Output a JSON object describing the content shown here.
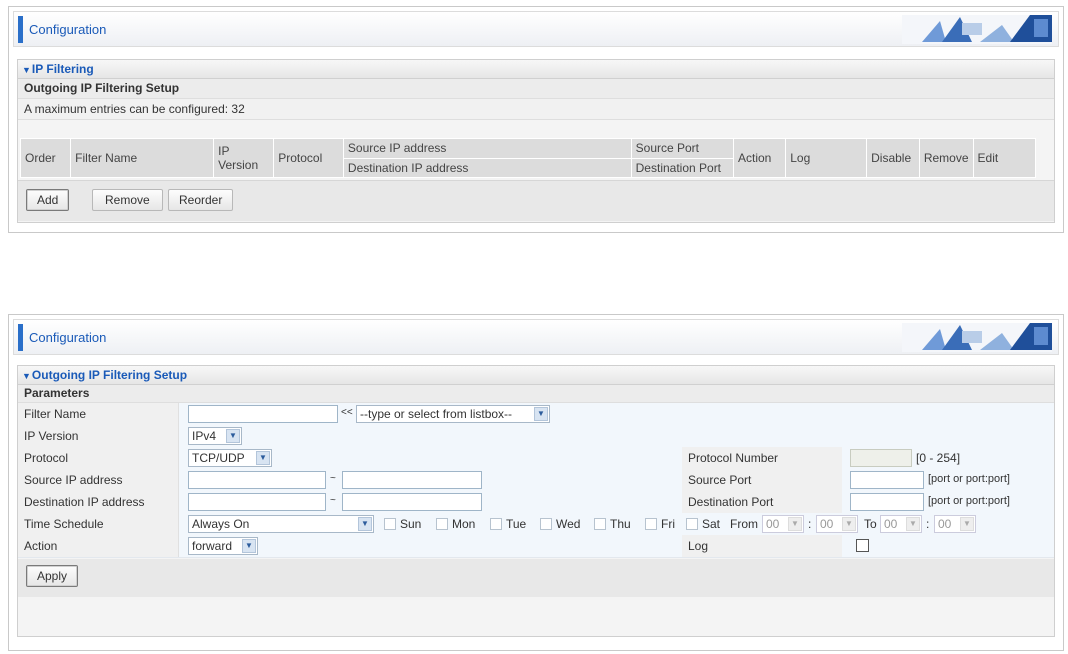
{
  "panel1": {
    "config_title": "Configuration",
    "section_title": "IP Filtering",
    "subheading": "Outgoing IP Filtering Setup",
    "max_entries_text": "A maximum entries can be configured: 32",
    "columns": {
      "order": "Order",
      "filter_name": "Filter Name",
      "ip_version": "IP Version",
      "protocol": "Protocol",
      "source_ip": "Source IP address",
      "destination_ip": "Destination IP address",
      "source_port": "Source Port",
      "destination_port": "Destination Port",
      "action": "Action",
      "log": "Log",
      "disable": "Disable",
      "remove": "Remove",
      "edit": "Edit"
    },
    "buttons": {
      "add": "Add",
      "remove": "Remove",
      "reorder": "Reorder"
    }
  },
  "panel2": {
    "config_title": "Configuration",
    "section_title": "Outgoing IP Filtering Setup",
    "parameters_label": "Parameters",
    "filter_name": {
      "label": "Filter Name",
      "value": "",
      "separator": "<<",
      "listbox": "--type or select from listbox--"
    },
    "ip_version": {
      "label": "IP Version",
      "value": "IPv4"
    },
    "protocol": {
      "label": "Protocol",
      "value": "TCP/UDP"
    },
    "protocol_number": {
      "label": "Protocol Number",
      "value": "",
      "hint": "[0 - 254]"
    },
    "source_ip": {
      "label": "Source IP address",
      "from": "",
      "tilde": "~",
      "to": ""
    },
    "source_port": {
      "label": "Source Port",
      "value": "",
      "hint": "[port or port:port]"
    },
    "destination_ip": {
      "label": "Destination IP address",
      "from": "",
      "tilde": "~",
      "to": ""
    },
    "destination_port": {
      "label": "Destination Port",
      "value": "",
      "hint": "[port or port:port]"
    },
    "time_schedule": {
      "label": "Time Schedule",
      "value": "Always On",
      "days": [
        "Sun",
        "Mon",
        "Tue",
        "Wed",
        "Thu",
        "Fri",
        "Sat"
      ],
      "from_label": "From",
      "from_hour": "00",
      "from_min": "00",
      "to_label": "To",
      "to_hour": "00",
      "to_min": "00",
      "colon": ":"
    },
    "action": {
      "label": "Action",
      "value": "forward"
    },
    "log": {
      "label": "Log",
      "checked": false
    },
    "apply_button": "Apply"
  },
  "colors": {
    "accent": "#2a6fc9",
    "title_text": "#1a5ab8",
    "row_blue": "#f2f7fc"
  }
}
